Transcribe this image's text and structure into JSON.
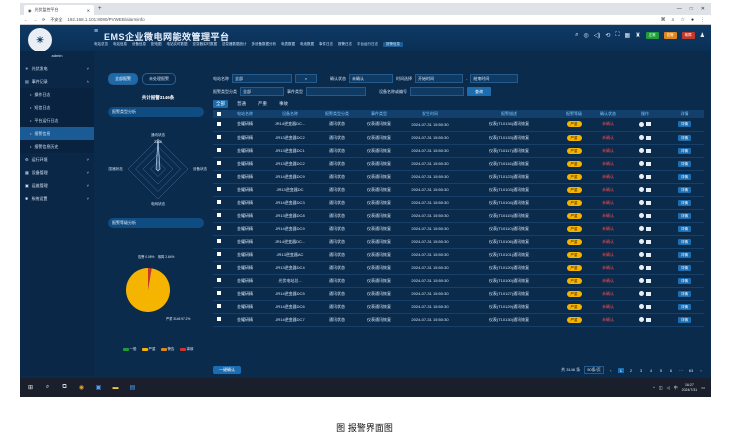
{
  "browser": {
    "tab_title": "光伏监控平台",
    "tab_close": "✕",
    "new_tab": "+",
    "window_controls": [
      "—",
      "□",
      "✕"
    ],
    "nav_buttons": [
      "←",
      "→",
      "⟳"
    ],
    "security_label": "不安全",
    "url": "192.168.1.101:8090/PVWEB/alarminfo"
  },
  "app": {
    "title": "EMS企业微电网能效管理平台",
    "user": "admin",
    "logo_text": "☀",
    "nav_menu": [
      "电站总览",
      "电站信息",
      "设备信息",
      "配电图",
      "电站实时数据",
      "逆变器实时数据",
      "逆变器数据统计",
      "多设备数据分析",
      "电表数据",
      "电池数据",
      "事件日志",
      "报警日志",
      "平台运行日志",
      "报警信息"
    ],
    "active_nav": "报警信息",
    "header_badges": [
      {
        "text": "正常",
        "color": "#1f9d3a"
      },
      {
        "text": "告警",
        "color": "#e0861a"
      },
      {
        "text": "故障",
        "color": "#c0392b"
      }
    ],
    "header_icon_names": [
      "search-icon",
      "settings-icon",
      "sound-icon",
      "refresh-icon",
      "expand-icon",
      "grid-icon",
      "notification-icon",
      "user-icon"
    ]
  },
  "sidebar": {
    "items": [
      {
        "label": "光伏发电",
        "icon": "☀",
        "expanded": false
      },
      {
        "label": "事件记录",
        "icon": "▤",
        "expanded": true
      },
      {
        "label": "操作日志",
        "sub": true
      },
      {
        "label": "短信日志",
        "sub": true
      },
      {
        "label": "平台运行日志",
        "sub": true
      },
      {
        "label": "报警信息",
        "sub": true,
        "active": true
      },
      {
        "label": "报警信息历史",
        "sub": true
      },
      {
        "label": "运行环境",
        "icon": "⚙",
        "expanded": false
      },
      {
        "label": "设备管理",
        "icon": "▦",
        "expanded": false
      },
      {
        "label": "运维管理",
        "icon": "▣",
        "expanded": false
      },
      {
        "label": "系统设置",
        "icon": "✱",
        "expanded": false
      }
    ]
  },
  "left": {
    "tabs": [
      "全部报警",
      "未处理报警"
    ],
    "active_tab": 0,
    "total_text": "共计报警3146条",
    "panel1_title": "报警类型分析",
    "panel2_title": "报警等级分析",
    "radar_labels": [
      "通讯状态",
      "设备状态",
      "电网状态",
      "逆变器状态"
    ],
    "radar_value_label": "3146",
    "pie_labels": [
      "告警 0.06%",
      "故障 2.64%",
      "严重 3146 97.2%"
    ],
    "legend": [
      {
        "label": "一般",
        "color": "#1f9d3a"
      },
      {
        "label": "严重",
        "color": "#f5b400"
      },
      {
        "label": "警告",
        "color": "#e0861a"
      },
      {
        "label": "事故",
        "color": "#d0342c"
      }
    ]
  },
  "filters": {
    "station_label": "电站名称",
    "station_value": "全部",
    "confirm_label": "确认状态",
    "confirm_value": "未确认",
    "time_label": "时间选择",
    "start_placeholder": "开始时间",
    "end_placeholder": "结束时间",
    "device_type_label": "报警类型分类",
    "device_type_value": "全部",
    "event_type_label": "事件类型",
    "device_id_label": "设备名称或编号",
    "query_button": "查询"
  },
  "status_tabs": [
    "全部",
    "普通",
    "严重",
    "事故"
  ],
  "active_status_tab": 0,
  "table": {
    "headers": [
      "",
      "电站名称",
      "设备名称",
      "报警类型分类",
      "事件类型",
      "发生时间",
      "报警描述",
      "报警等级",
      "确认状态",
      "操作",
      "详情"
    ],
    "rows": [
      {
        "station": "金耀研精",
        "device": "JR14逆变器DC...",
        "category": "通讯状态",
        "event": "仪表通讯恢复",
        "time": "2024-07-31 15:50:30",
        "desc": "仪表(T10134)通讯恢复",
        "level": "严重",
        "status": "未确认",
        "detail": "详情"
      },
      {
        "station": "金耀研精",
        "device": "JR13逆变器DC2",
        "category": "通讯状态",
        "event": "仪表通讯恢复",
        "time": "2024-07-31 15:50:30",
        "desc": "仪表(T10133)通讯恢复",
        "level": "严重",
        "status": "未确认",
        "detail": "详情"
      },
      {
        "station": "金耀研精",
        "device": "JR13逆变器DC1",
        "category": "通讯状态",
        "event": "仪表通讯恢复",
        "time": "2024-07-31 15:50:30",
        "desc": "仪表(T10117)通讯恢复",
        "level": "严重",
        "status": "未确认",
        "detail": "详情"
      },
      {
        "station": "金耀研精",
        "device": "JR13逆变器DC2",
        "category": "通讯状态",
        "event": "仪表通讯恢复",
        "time": "2024-07-31 15:50:30",
        "desc": "仪表(T10116)通讯恢复",
        "level": "严重",
        "status": "未确认",
        "detail": "详情"
      },
      {
        "station": "金耀研精",
        "device": "JR14逆变器DC9",
        "category": "通讯状态",
        "event": "仪表通讯恢复",
        "time": "2024-07-31 15:50:30",
        "desc": "仪表(T10123)通讯恢复",
        "level": "严重",
        "status": "未确认",
        "detail": "详情"
      },
      {
        "station": "金耀研精",
        "device": "JR13逆变器DC",
        "category": "通讯状态",
        "event": "仪表通讯恢复",
        "time": "2024-07-31 15:50:30",
        "desc": "仪表(T10103)通讯恢复",
        "level": "严重",
        "status": "未确认",
        "detail": "详情"
      },
      {
        "station": "金耀研精",
        "device": "JR14逆变器DC3",
        "category": "通讯状态",
        "event": "仪表通讯恢复",
        "time": "2024-07-31 15:50:30",
        "desc": "仪表(T10104)通讯恢复",
        "level": "严重",
        "status": "未确认",
        "detail": "详情"
      },
      {
        "station": "金耀研精",
        "device": "JR13逆变器DC8",
        "category": "通讯状态",
        "event": "仪表通讯恢复",
        "time": "2024-07-31 15:50:30",
        "desc": "仪表(T10115)通讯恢复",
        "level": "严重",
        "status": "未确认",
        "detail": "详情"
      },
      {
        "station": "金耀研精",
        "device": "JR14逆变器DC9",
        "category": "通讯状态",
        "event": "仪表通讯恢复",
        "time": "2024-07-31 15:50:30",
        "desc": "仪表(T10110)通讯恢复",
        "level": "严重",
        "status": "未确认",
        "detail": "详情"
      },
      {
        "station": "金耀研精",
        "device": "JR14逆变器DC...",
        "category": "通讯状态",
        "event": "仪表通讯恢复",
        "time": "2024-07-31 15:50:30",
        "desc": "仪表(T10106)通讯恢复",
        "level": "严重",
        "status": "未确认",
        "detail": "详情"
      },
      {
        "station": "金耀研精",
        "device": "JR13逆变器AC",
        "category": "通讯状态",
        "event": "仪表通讯恢复",
        "time": "2024-07-31 15:50:30",
        "desc": "仪表(T10101)通讯恢复",
        "level": "严重",
        "status": "未确认",
        "detail": "详情"
      },
      {
        "station": "金耀研精",
        "device": "JR13逆变器DC4",
        "category": "通讯状态",
        "event": "仪表通讯恢复",
        "time": "2024-07-31 15:50:30",
        "desc": "仪表(T10120)通讯恢复",
        "level": "严重",
        "status": "未确认",
        "detail": "详情"
      },
      {
        "station": "金耀研精",
        "device": "光伏电站总...",
        "category": "通讯状态",
        "event": "仪表通讯恢复",
        "time": "2024-07-31 15:50:30",
        "desc": "仪表(T10100)通讯恢复",
        "level": "严重",
        "status": "未确认",
        "detail": "详情"
      },
      {
        "station": "金耀研精",
        "device": "JR14逆变器DC5",
        "category": "通讯状态",
        "event": "仪表通讯恢复",
        "time": "2024-07-31 15:50:30",
        "desc": "仪表(T10127)通讯恢复",
        "level": "严重",
        "status": "未确认",
        "detail": "详情"
      },
      {
        "station": "金耀研精",
        "device": "JR14逆变器DC6",
        "category": "通讯状态",
        "event": "仪表通讯恢复",
        "time": "2024-07-31 15:50:30",
        "desc": "仪表(T10129)通讯恢复",
        "level": "严重",
        "status": "未确认",
        "detail": "详情"
      },
      {
        "station": "金耀研精",
        "device": "JR14逆变器DC7",
        "category": "通讯状态",
        "event": "仪表通讯恢复",
        "time": "2024-07-31 15:50:30",
        "desc": "仪表(T10130)通讯恢复",
        "level": "严重",
        "status": "未确认",
        "detail": "详情"
      }
    ]
  },
  "footer": {
    "batch_button": "一键确认",
    "total_text": "共 3146 条",
    "page_size": "50条/页",
    "pages": [
      "‹",
      "1",
      "2",
      "3",
      "4",
      "5",
      "6",
      "···",
      "63",
      "›"
    ],
    "active_page": "1"
  },
  "taskbar": {
    "clock_time": "16:27",
    "clock_date": "2024/7/31"
  },
  "caption": "图  报警界面图",
  "chart_data": [
    {
      "type": "radar",
      "title": "报警类型分析",
      "categories": [
        "通讯状态",
        "设备状态",
        "电网状态",
        "逆变器状态"
      ],
      "values": [
        3146,
        0,
        0,
        0
      ]
    },
    {
      "type": "pie",
      "title": "报警等级分析",
      "categories": [
        "告警",
        "故障",
        "严重"
      ],
      "values": [
        0.06,
        2.64,
        97.2
      ],
      "colors": [
        "#e0861a",
        "#d0342c",
        "#f5b400"
      ]
    }
  ]
}
